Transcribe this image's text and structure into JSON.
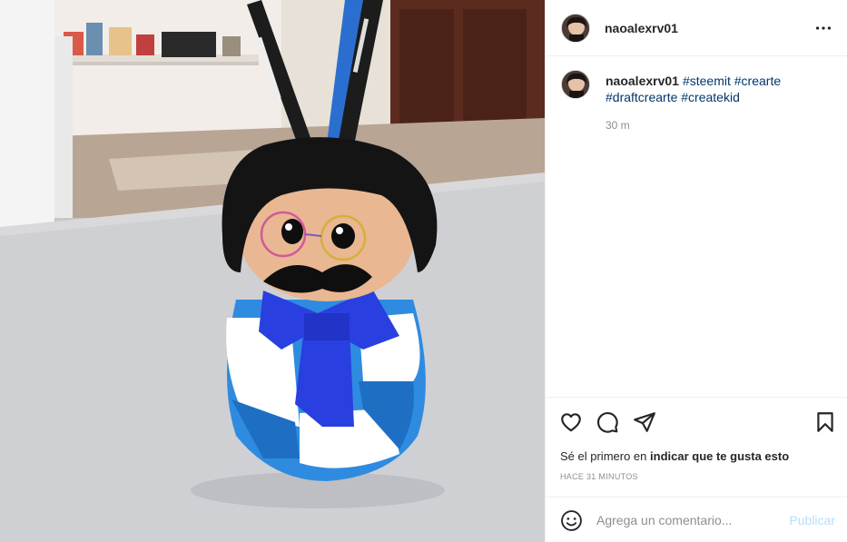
{
  "post": {
    "image_description_icon": "photo-of-handmade-pencil-holder-doll",
    "username": "naoalexrv01",
    "more_icon": "more-horizontal-icon"
  },
  "caption": {
    "username": "naoalexrv01",
    "tags": [
      "#steemit",
      "#crearte",
      "#draftcrearte",
      "#createkid"
    ],
    "time": "30 m"
  },
  "actions": {
    "like_icon": "heart-icon",
    "comment_icon": "comment-icon",
    "share_icon": "share-icon",
    "save_icon": "bookmark-icon",
    "likes_prefix": "Sé el primero en",
    "likes_link": "indicar que te gusta esto",
    "posted_ago": "HACE 31 MINUTOS"
  },
  "comment": {
    "emoji_icon": "emoji-icon",
    "placeholder": "Agrega un comentario...",
    "publish_label": "Publicar"
  },
  "colors": {
    "tag": "#00376b",
    "muted": "#8e8e8e",
    "publish_disabled": "#b2dffc",
    "border": "#efefef"
  }
}
